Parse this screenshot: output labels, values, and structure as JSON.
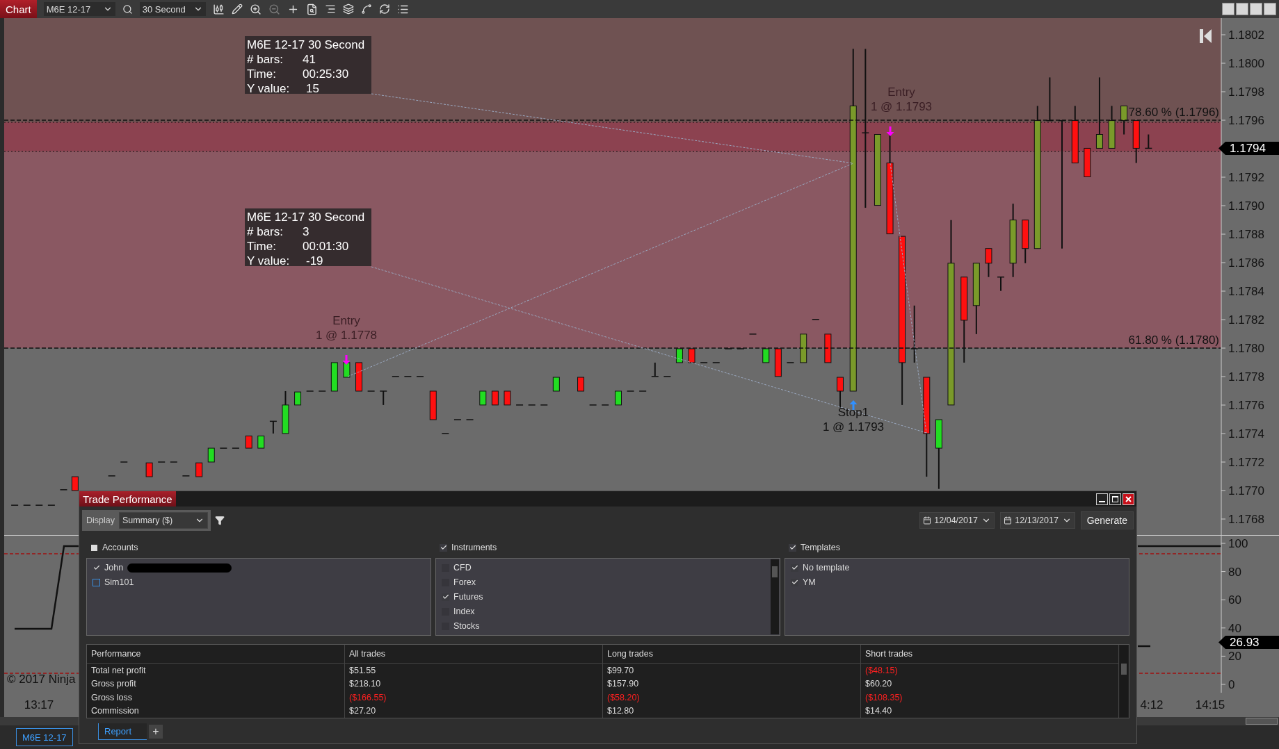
{
  "toolbar": {
    "title": "Chart",
    "instrument": "M6E 12-17",
    "interval": "30 Second"
  },
  "price_axis": {
    "ticks": [
      "1.1802",
      "1.1800",
      "1.1798",
      "1.1796",
      "1.1792",
      "1.1790",
      "1.1788",
      "1.1786",
      "1.1784",
      "1.1782",
      "1.1780",
      "1.1778",
      "1.1776",
      "1.1774",
      "1.1772",
      "1.1770",
      "1.1768"
    ],
    "current": "1.1794"
  },
  "fib_levels": [
    "78.60 % (1.1796)",
    "61.80 % (1.1780)"
  ],
  "measure_tooltips": [
    {
      "title": "M6E 12-17 30 Second",
      "rows": [
        {
          "label": "# bars:",
          "value": "41"
        },
        {
          "label": "Time:",
          "value": "00:25:30"
        },
        {
          "label": "Y value:",
          "value": "15"
        }
      ]
    },
    {
      "title": "M6E 12-17 30 Second",
      "rows": [
        {
          "label": "# bars:",
          "value": "3"
        },
        {
          "label": "Time:",
          "value": "00:01:30"
        },
        {
          "label": "Y value:",
          "value": "-19"
        }
      ]
    }
  ],
  "executions": [
    {
      "kind": "entry",
      "name": "Entry",
      "detail": "1 @ 1.1778"
    },
    {
      "kind": "entry",
      "name": "Entry",
      "detail": "1 @ 1.1793"
    },
    {
      "kind": "stop",
      "name": "Stop1",
      "detail": "1 @ 1.1793"
    }
  ],
  "indicator_axis": {
    "ticks": [
      "100",
      "80",
      "60",
      "40",
      "20",
      "0"
    ],
    "current": "26.93"
  },
  "time_axis": [
    "13:17",
    "4:12",
    "14:15"
  ],
  "copyright": "© 2017 Ninja",
  "chart_tabs": [
    {
      "label": "M6E 12-17",
      "selected": true
    }
  ],
  "trade_performance": {
    "title": "Trade Performance",
    "display_label": "Display",
    "display_value": "Summary ($)",
    "start_date": "12/04/2017",
    "end_date": "12/13/2017",
    "generate": "Generate",
    "filters": [
      {
        "title": "Accounts",
        "kind": "boxed",
        "checked": false,
        "items": [
          {
            "label": "John",
            "checked": true,
            "redacted": true
          },
          {
            "label": "Sim101",
            "checked": false,
            "redacted": false
          }
        ]
      },
      {
        "title": "Instruments",
        "kind": "plain",
        "checked": true,
        "scroll": true,
        "items": [
          {
            "label": "CFD",
            "checked": false
          },
          {
            "label": "Forex",
            "checked": false
          },
          {
            "label": "Futures",
            "checked": true
          },
          {
            "label": "Index",
            "checked": false
          },
          {
            "label": "Stocks",
            "checked": false
          }
        ]
      },
      {
        "title": "Templates",
        "kind": "plain",
        "checked": true,
        "items": [
          {
            "label": "No template",
            "checked": true
          },
          {
            "label": "YM",
            "checked": true
          }
        ]
      }
    ],
    "table": {
      "columns": [
        "Performance",
        "All trades",
        "Long trades",
        "Short trades"
      ],
      "rows": [
        [
          {
            "text": "Total net profit",
            "loss": false
          },
          {
            "text": "$51.55",
            "loss": false
          },
          {
            "text": "$99.70",
            "loss": false
          },
          {
            "text": "($48.15)",
            "loss": true
          }
        ],
        [
          {
            "text": "Gross profit",
            "loss": false
          },
          {
            "text": "$218.10",
            "loss": false
          },
          {
            "text": "$157.90",
            "loss": false
          },
          {
            "text": "$60.20",
            "loss": false
          }
        ],
        [
          {
            "text": "Gross loss",
            "loss": false
          },
          {
            "text": "($166.55)",
            "loss": true
          },
          {
            "text": "($58.20)",
            "loss": true
          },
          {
            "text": "($108.35)",
            "loss": true
          }
        ],
        [
          {
            "text": "Commission",
            "loss": false
          },
          {
            "text": "$27.20",
            "loss": false
          },
          {
            "text": "$12.80",
            "loss": false
          },
          {
            "text": "$14.40",
            "loss": false
          }
        ]
      ]
    },
    "tabs": [
      {
        "label": "Report",
        "selected": true
      }
    ],
    "add_tab": "+"
  }
}
